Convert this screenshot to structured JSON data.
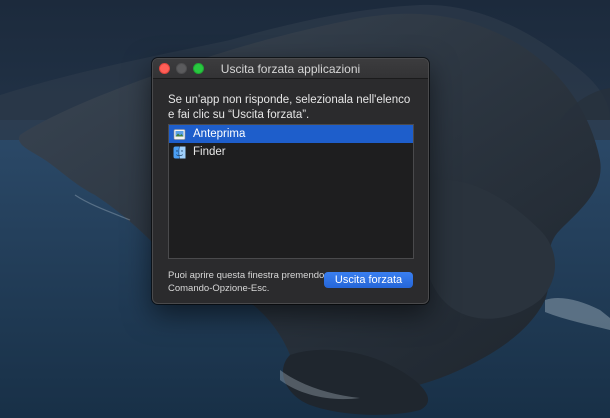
{
  "window": {
    "title": "Uscita forzata applicazioni",
    "message": "Se un'app non risponde, selezionala nell'elenco e fai clic su “Uscita forzata”.",
    "apps": [
      {
        "name": "Anteprima",
        "icon": "preview-icon",
        "selected": true
      },
      {
        "name": "Finder",
        "icon": "finder-icon",
        "selected": false
      }
    ],
    "hint": "Puoi aprire questa finestra premendo Comando-Opzione-Esc.",
    "force_quit_label": "Uscita forzata"
  },
  "colors": {
    "accent": "#1e5ecb",
    "close": "#ff5f57",
    "zoom": "#28c840",
    "window_bg": "#2b2b2d"
  }
}
